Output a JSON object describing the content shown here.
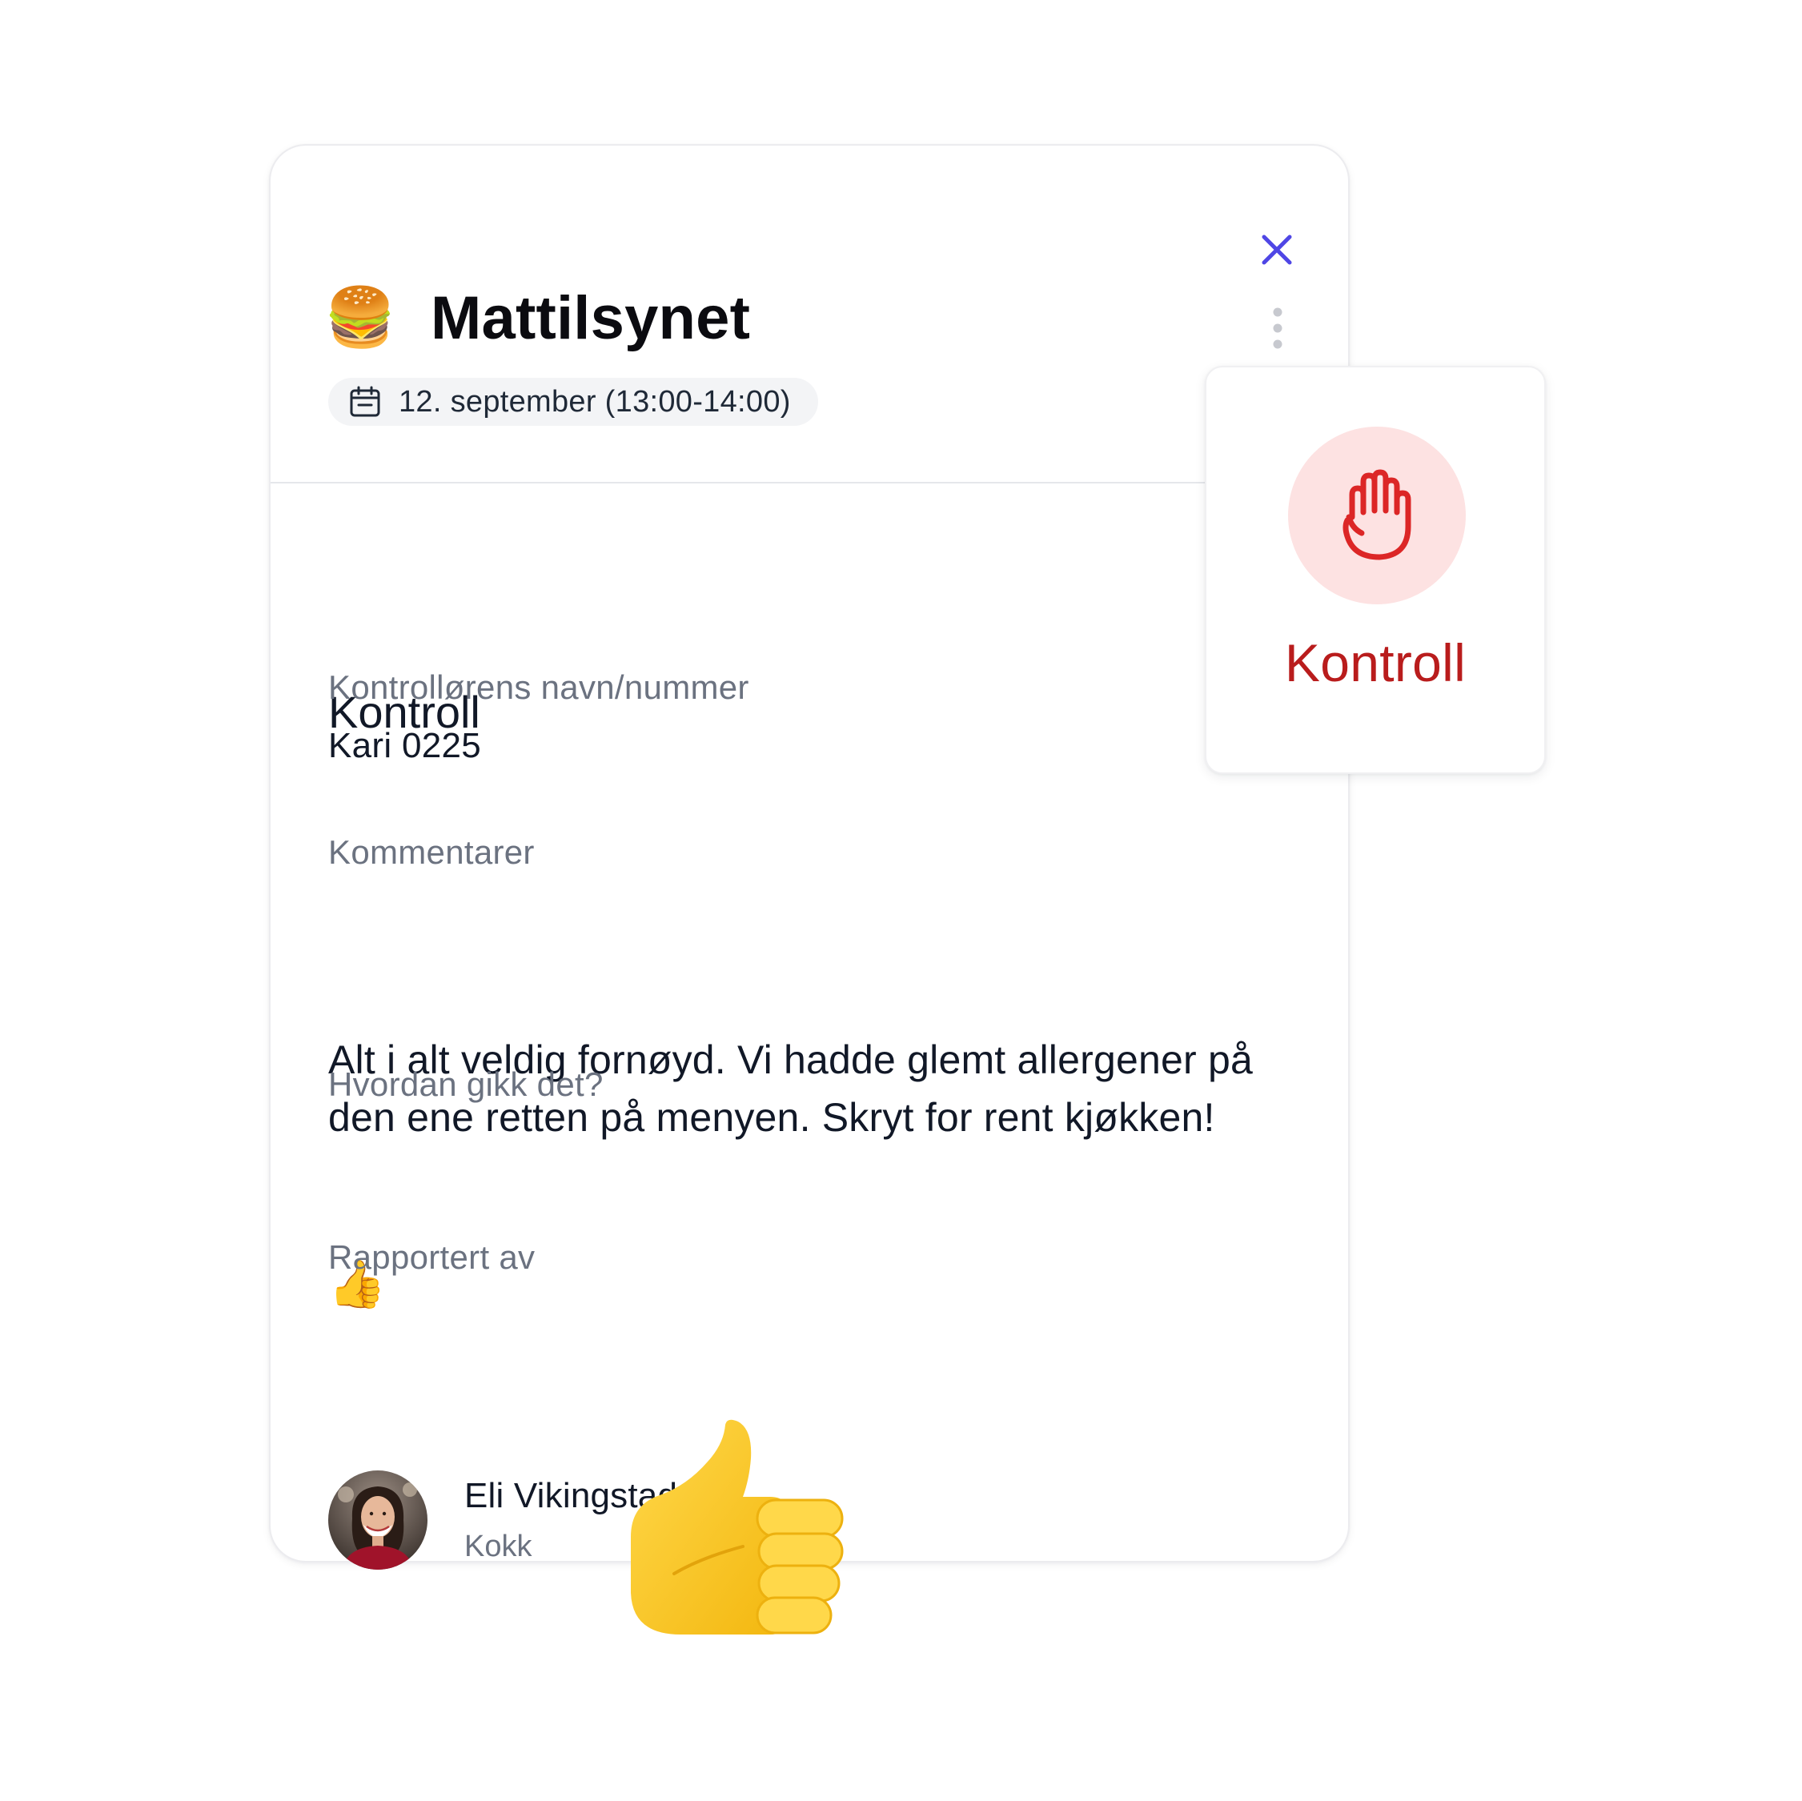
{
  "dialog": {
    "title_emoji": "🍔",
    "title": "Mattilsynet",
    "date": "12. september (13:00-14:00)",
    "close_icon": "close-icon",
    "more_icon": "vertical-dots-icon",
    "calendar_icon": "calendar-icon"
  },
  "details": {
    "section_title": "Kontroll",
    "inspector_label": "Kontrollørens navn/nummer",
    "inspector_value": "Kari 0225",
    "comments_label": "Kommentarer",
    "comments_value": "Alt i alt veldig fornøyd. Vi hadde glemt allergener på den ene retten på menyen. Skryt for rent kjøkken!",
    "rating_label": "Hvordan gikk det?",
    "rating_emoji": "👍",
    "reported_by_label": "Rapportert av"
  },
  "reporter": {
    "name": "Eli Vikingstad",
    "role": "Kokk"
  },
  "status_card": {
    "icon": "raised-hand-icon",
    "label": "Kontroll"
  },
  "colors": {
    "accent": "#4f46e5",
    "status_red": "#dc2626",
    "status_bg": "#fde2e2",
    "muted_text": "#6b7280"
  }
}
